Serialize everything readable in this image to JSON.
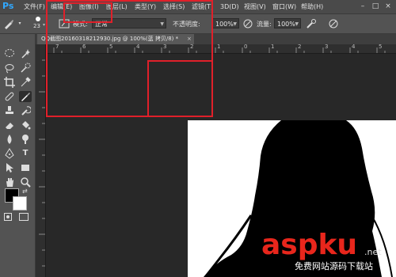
{
  "app": {
    "logo": "Ps"
  },
  "menubar": {
    "items": [
      "文件(F)",
      "编辑(E)",
      "图像(I)",
      "图层(L)",
      "类型(Y)",
      "选择(S)",
      "滤镜(T)",
      "3D(D)",
      "视图(V)",
      "窗口(W)",
      "帮助(H)"
    ],
    "window_controls": [
      "–",
      "□",
      "×"
    ]
  },
  "options": {
    "brush_size": "23",
    "mode_label": "模式:",
    "mode_value": "正常",
    "opacity_label": "不透明度:",
    "opacity_value": "100%",
    "flow_label": "流量:",
    "flow_value": "100%"
  },
  "document": {
    "tab_title": "QQ截图20160318212930.jpg @ 100%(蓝 拷贝/8) *",
    "close": "×"
  },
  "ruler": {
    "h_ticks": [
      "7",
      "6",
      "5",
      "4",
      "3",
      "2",
      "1",
      "0",
      "1",
      "2",
      "3",
      "4",
      "5"
    ]
  },
  "watermark": {
    "brand": "aspku",
    "dotnet": ".net",
    "sub": "免费网站源码下载站"
  },
  "colors": {
    "highlight": "#e0202a",
    "menubar": "#4a4a4a",
    "panel": "#535353",
    "canvas_bg": "#282828"
  }
}
